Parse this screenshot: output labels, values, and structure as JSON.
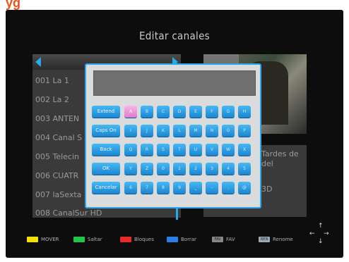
{
  "logo_fragment": "yg",
  "title": "Editar canales",
  "channels": [
    "001 La 1",
    "002 La 2",
    "003 ANTEN",
    "004 Canal S",
    "005 Telecin",
    "006 CUATR",
    "007 laSexta",
    "008 CanalSur HD"
  ],
  "info": {
    "line1": "Tardes de",
    "line2": "del",
    "line3": "3D"
  },
  "keyboard": {
    "input_value": "",
    "functions": [
      "Extend",
      "Caps On",
      "Back",
      "OK",
      "Cancelar"
    ],
    "rows": [
      [
        "A",
        "B",
        "C",
        "D",
        "E",
        "F",
        "G",
        "H"
      ],
      [
        "I",
        "J",
        "K",
        "L",
        "M",
        "N",
        "O",
        "P"
      ],
      [
        "Q",
        "R",
        "S",
        "T",
        "U",
        "V",
        "W",
        "X"
      ],
      [
        "Y",
        "Z",
        "0",
        "1",
        "2",
        "3",
        "4",
        "5"
      ],
      [
        "6",
        "7",
        "8",
        "9",
        "_",
        "-",
        ".",
        "@"
      ]
    ],
    "selected_key": "A"
  },
  "footer": [
    {
      "label": "MOVER",
      "color": "#f2e200"
    },
    {
      "label": "Saltar",
      "color": "#23c44a"
    },
    {
      "label": "Bloques",
      "color": "#e42a2a"
    },
    {
      "label": "Borrar",
      "color": "#2a7ee4"
    },
    {
      "label": "FAV",
      "badge": "FAV"
    },
    {
      "label": "Renome",
      "badge": "REN"
    }
  ],
  "nav_arrows": {
    "up": "↑",
    "down": "↓",
    "left": "←",
    "right": "→"
  }
}
